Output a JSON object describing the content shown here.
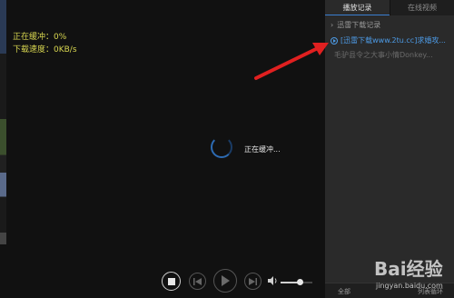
{
  "status": {
    "buffer_text": "正在缓冲：0%",
    "speed_text": "下载速度：0KB/s"
  },
  "player": {
    "buffering_label": "正在缓冲...",
    "controls": {
      "stop": "stop-icon",
      "prev": "previous-icon",
      "play": "play-icon",
      "next": "next-icon",
      "volume": "speaker-icon",
      "volume_level": 0.6
    }
  },
  "playlist": {
    "tabs": [
      {
        "label": "播放记录",
        "active": true
      },
      {
        "label": "在线视频",
        "active": false
      }
    ],
    "folder_label": "迅雷下载记录",
    "items": [
      {
        "label": "[迅雷下载www.2tu.cc]求婚攻..."
      },
      {
        "label": "毛驴县令之大事小情Donkey..."
      }
    ],
    "bottom": {
      "left_label": "全部",
      "right_label": "列表循环"
    }
  },
  "watermark": {
    "title": "Bai经验",
    "subtitle": "jingyan.baidu.com"
  },
  "colors": {
    "status_text": "#d8d650",
    "accent_blue": "#4d9be6",
    "annotation_red": "#e02020"
  }
}
